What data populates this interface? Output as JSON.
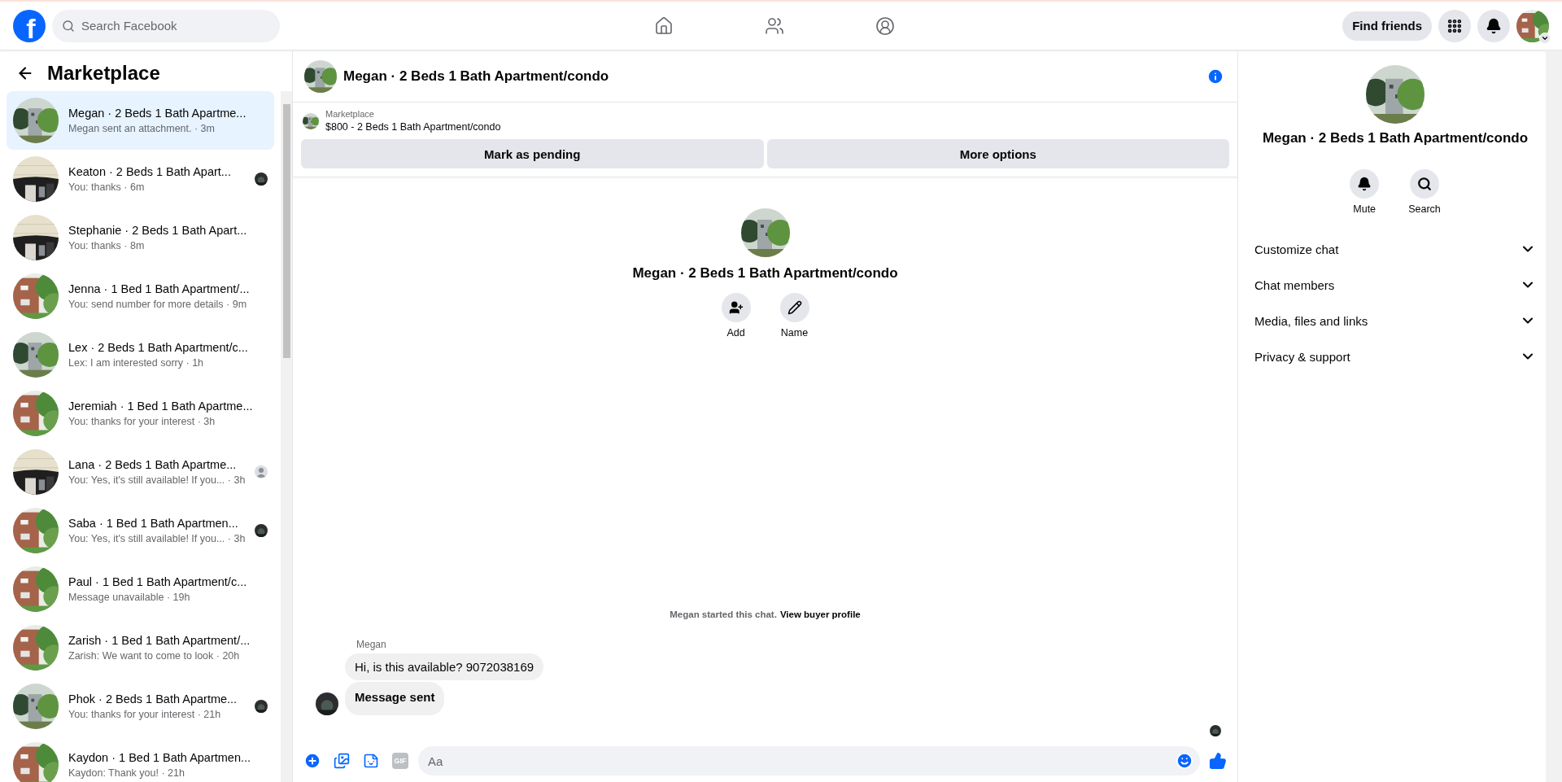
{
  "top_bar": {
    "logo": "f",
    "search": {
      "placeholder": "Search Facebook"
    },
    "find_friends": "Find friends"
  },
  "sidebar": {
    "title": "Marketplace",
    "conversations": [
      {
        "title": "Megan · 2 Beds 1 Bath Apartme...",
        "preview": "Megan sent an attachment. · 3m",
        "selected": true
      },
      {
        "title": "Keaton · 2 Beds 1 Bath Apart...",
        "preview": "You: thanks · 6m",
        "selected": false
      },
      {
        "title": "Stephanie · 2 Beds 1 Bath Apart...",
        "preview": "You: thanks · 8m",
        "selected": false
      },
      {
        "title": "Jenna · 1 Bed 1 Bath Apartment/...",
        "preview": "You: send number for more details · 9m",
        "selected": false
      },
      {
        "title": "Lex · 2 Beds 1 Bath Apartment/c...",
        "preview": "Lex: I am interested sorry · 1h",
        "selected": false
      },
      {
        "title": "Jeremiah · 1 Bed 1 Bath Apartme...",
        "preview": "You: thanks for your interest · 3h",
        "selected": false
      },
      {
        "title": "Lana · 2 Beds 1 Bath Apartme...",
        "preview": "You: Yes, it's still available! If you... · 3h",
        "selected": false,
        "receipt": {
          "kind": "generic"
        }
      },
      {
        "title": "Saba · 1 Bed 1 Bath Apartmen...",
        "preview": "You: Yes, it's still available! If you... · 3h",
        "selected": false
      },
      {
        "title": "Paul · 1 Bed 1 Bath Apartment/c...",
        "preview": "Message unavailable · 19h",
        "selected": false
      },
      {
        "title": "Zarish · 1 Bed 1 Bath Apartment/...",
        "preview": "Zarish: We want to come to look · 20h",
        "selected": false
      },
      {
        "title": "Phok · 2 Beds 1 Bath Apartme...",
        "preview": "You: thanks for your interest · 21h",
        "selected": false
      },
      {
        "title": "Kaydon · 1 Bed 1 Bath Apartmen...",
        "preview": "Kaydon: Thank you! · 21h",
        "selected": false
      }
    ]
  },
  "chat": {
    "title": "Megan · 2 Beds 1 Bath Apartment/condo",
    "listing": {
      "source": "Marketplace",
      "summary": "$800 - 2 Beds 1 Bath Apartment/condo"
    },
    "actions": [
      "Mark as pending",
      "More options"
    ],
    "intro": {
      "name": "Megan · 2 Beds 1 Bath Apartment/condo",
      "buttons": [
        {
          "kind": "add",
          "label": "Add"
        },
        {
          "kind": "name",
          "label": "Name"
        }
      ]
    },
    "notice": {
      "text": "Megan started this chat.",
      "link": "View buyer profile"
    },
    "sender": "Megan",
    "messages": [
      {
        "kind": "text",
        "text": "Hi, is this available? 9072038169"
      },
      {
        "kind": "status",
        "text": "Message sent"
      }
    ],
    "composer": {
      "gif": "GIF",
      "placeholder": "Aa"
    }
  },
  "details": {
    "name": "Megan · 2 Beds 1 Bath Apartment/condo",
    "actions": [
      {
        "kind": "mute",
        "label": "Mute"
      },
      {
        "kind": "search",
        "label": "Search"
      }
    ],
    "sections": [
      {
        "label": "Customize chat",
        "expanded": false
      },
      {
        "label": "Chat members",
        "expanded": false
      },
      {
        "label": "Media, files and links",
        "expanded": false
      },
      {
        "label": "Privacy & support",
        "expanded": false
      }
    ]
  }
}
